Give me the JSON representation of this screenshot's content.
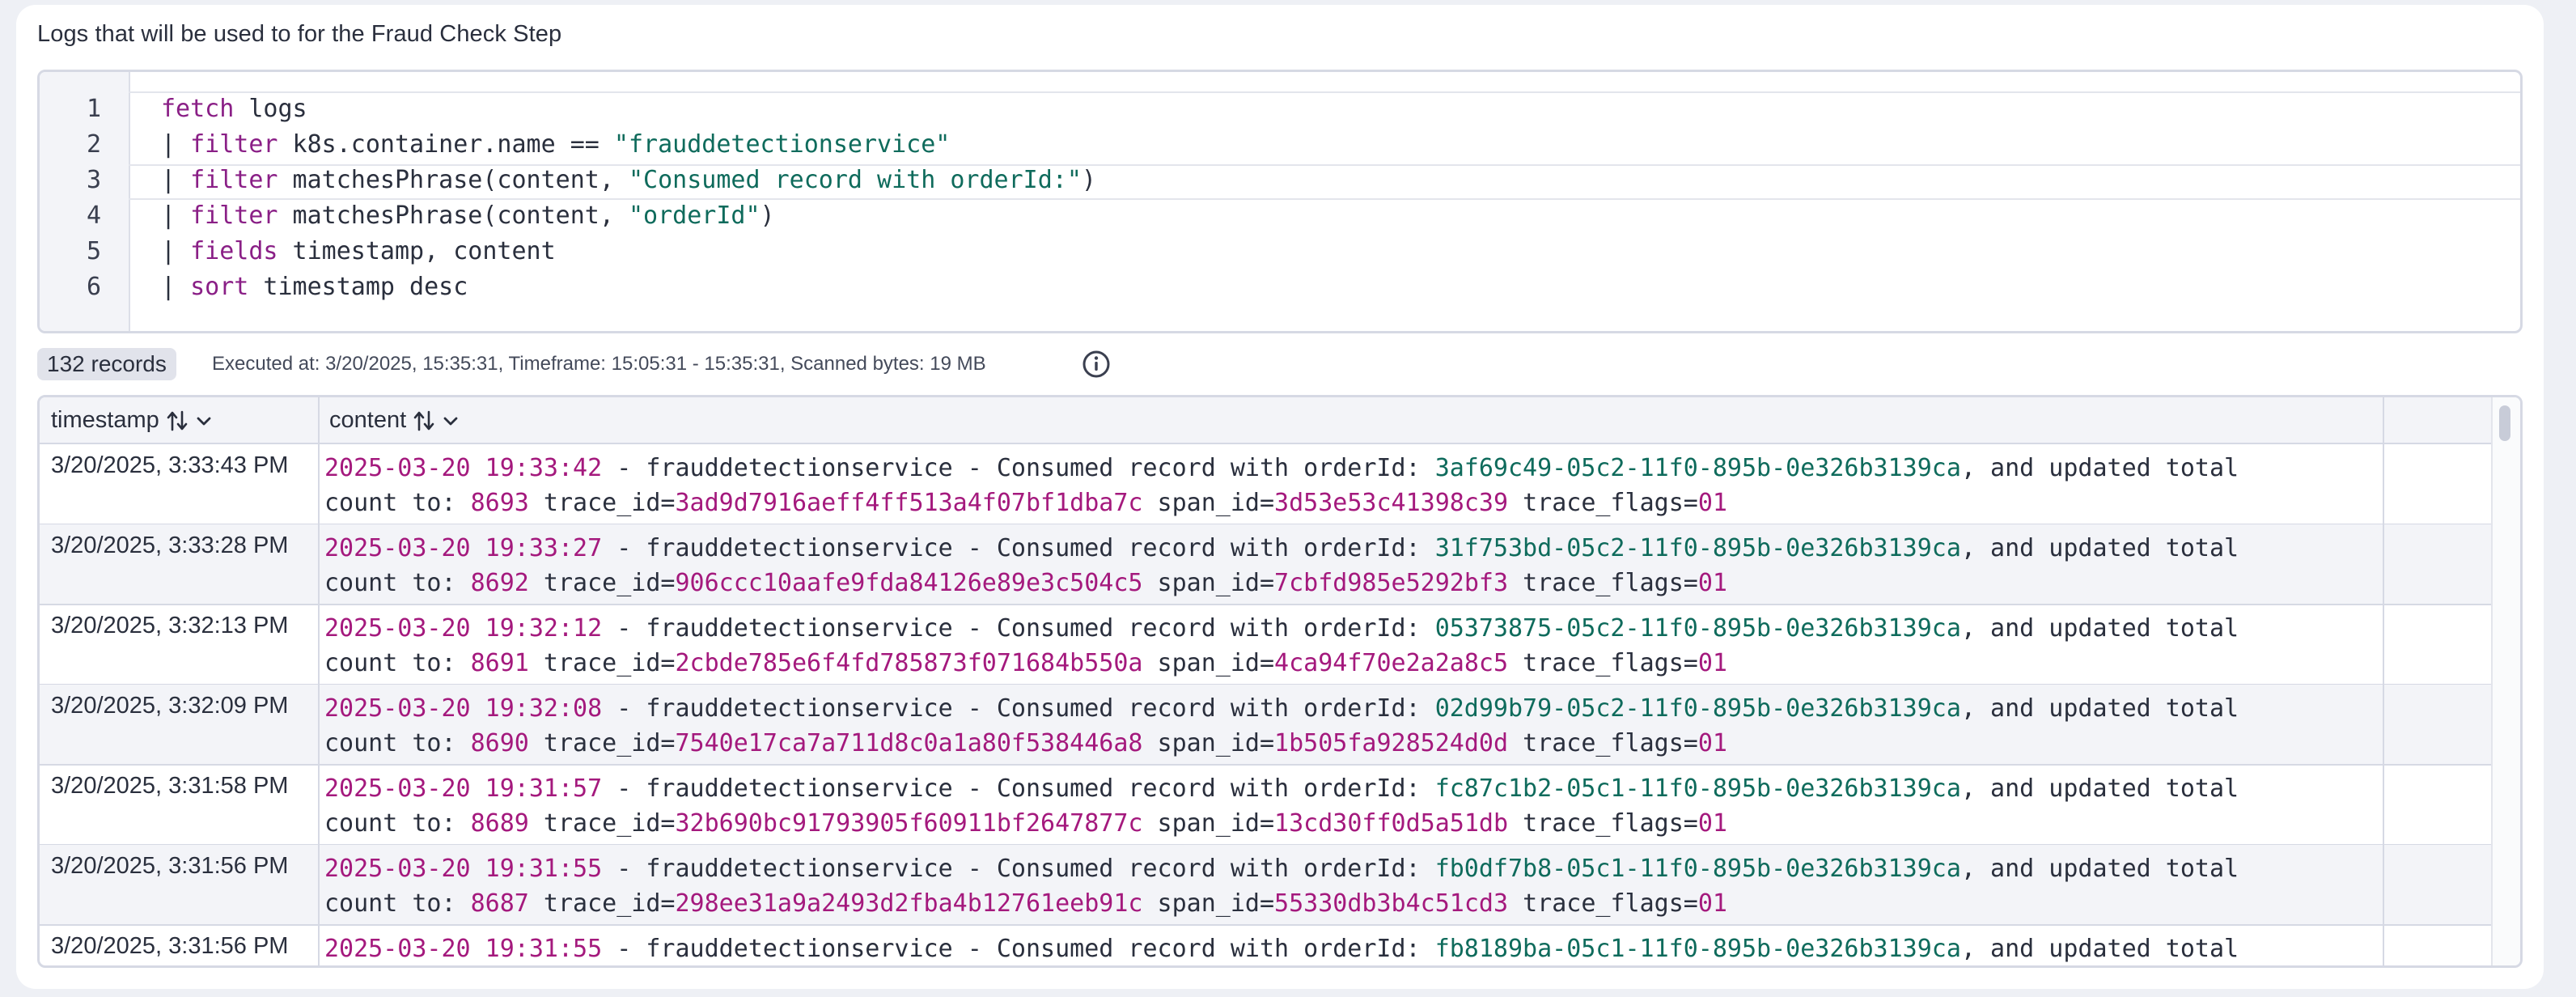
{
  "section_title": "Logs that will be used to for the Fraud Check Step",
  "query": {
    "line_numbers": [
      "1",
      "2",
      "3",
      "4",
      "5",
      "6"
    ],
    "pipe": "| ",
    "lines": [
      {
        "kw": "fetch",
        "rest": " logs"
      },
      {
        "kw": "filter",
        "mid": " k8s.container.name == ",
        "str": "\"frauddetectionservice\""
      },
      {
        "kw": "filter",
        "mid": " matchesPhrase(content, ",
        "str": "\"Consumed record with orderId:\"",
        "end": ")"
      },
      {
        "kw": "filter",
        "mid": " matchesPhrase(content, ",
        "str": "\"orderId\"",
        "end": ")"
      },
      {
        "kw": "fields",
        "rest": " timestamp, content"
      },
      {
        "kw": "sort",
        "rest": " timestamp desc"
      }
    ]
  },
  "status": {
    "records": "132 records",
    "executed_info": "Executed at: 3/20/2025, 15:35:31, Timeframe: 15:05:31 - 15:35:31, Scanned bytes: 19 MB",
    "info_icon": "info-circle-icon"
  },
  "table": {
    "columns": [
      {
        "label": "timestamp",
        "icons": [
          "sort-icon",
          "chevron-down-icon"
        ]
      },
      {
        "label": "content",
        "icons": [
          "sort-icon",
          "chevron-down-icon"
        ]
      }
    ],
    "content_parts": {
      "service": " - frauddetectionservice - Consumed record with orderId: ",
      "updated": ", and updated total",
      "count_to": "count to: ",
      "trace_id": " trace_id=",
      "span_id": " span_id=",
      "trace_flags": " trace_flags="
    },
    "rows": [
      {
        "timestamp": "3/20/2025, 3:33:43 PM",
        "logtime": "2025-03-20 19:33:42",
        "order_id": "3af69c49-05c2-11f0-895b-0e326b3139ca",
        "count": "8693",
        "trace_id": "3ad9d7916aeff4ff513a4f07bf1dba7c",
        "span_id": "3d53e53c41398c39",
        "trace_flags": "01"
      },
      {
        "timestamp": "3/20/2025, 3:33:28 PM",
        "logtime": "2025-03-20 19:33:27",
        "order_id": "31f753bd-05c2-11f0-895b-0e326b3139ca",
        "count": "8692",
        "trace_id": "906ccc10aafe9fda84126e89e3c504c5",
        "span_id": "7cbfd985e5292bf3",
        "trace_flags": "01"
      },
      {
        "timestamp": "3/20/2025, 3:32:13 PM",
        "logtime": "2025-03-20 19:32:12",
        "order_id": "05373875-05c2-11f0-895b-0e326b3139ca",
        "count": "8691",
        "trace_id": "2cbde785e6f4fd785873f071684b550a",
        "span_id": "4ca94f70e2a2a8c5",
        "trace_flags": "01"
      },
      {
        "timestamp": "3/20/2025, 3:32:09 PM",
        "logtime": "2025-03-20 19:32:08",
        "order_id": "02d99b79-05c2-11f0-895b-0e326b3139ca",
        "count": "8690",
        "trace_id": "7540e17ca7a711d8c0a1a80f538446a8",
        "span_id": "1b505fa928524d0d",
        "trace_flags": "01"
      },
      {
        "timestamp": "3/20/2025, 3:31:58 PM",
        "logtime": "2025-03-20 19:31:57",
        "order_id": "fc87c1b2-05c1-11f0-895b-0e326b3139ca",
        "count": "8689",
        "trace_id": "32b690bc91793905f60911bf2647877c",
        "span_id": "13cd30ff0d5a51db",
        "trace_flags": "01"
      },
      {
        "timestamp": "3/20/2025, 3:31:56 PM",
        "logtime": "2025-03-20 19:31:55",
        "order_id": "fb0df7b8-05c1-11f0-895b-0e326b3139ca",
        "count": "8687",
        "trace_id": "298ee31a9a2493d2fba4b12761eeb91c",
        "span_id": "55330db3b4c51cd3",
        "trace_flags": "01"
      },
      {
        "timestamp": "3/20/2025, 3:31:56 PM",
        "logtime": "2025-03-20 19:31:55",
        "order_id": "fb8189ba-05c1-11f0-895b-0e326b3139ca"
      }
    ]
  },
  "colors": {
    "keyword": "#8a1f86",
    "string": "#0f6b5c",
    "number": "#a4197d",
    "border": "#d6d9e4"
  }
}
